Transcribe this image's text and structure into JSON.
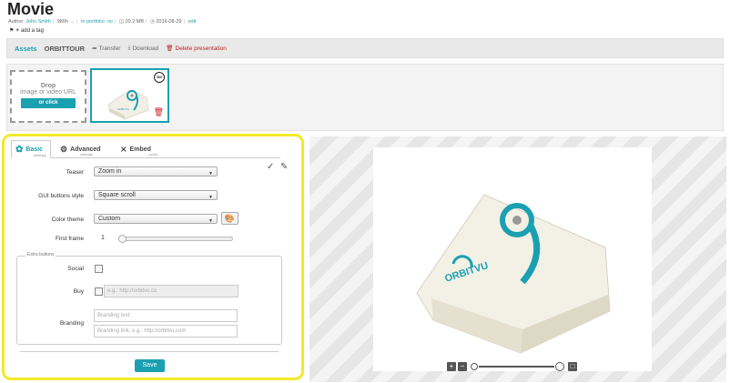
{
  "header": {
    "title": "Movie",
    "meta": {
      "author_label": "Author:",
      "author_name": "John Smith",
      "views": "980h",
      "arrow": "→",
      "portfolio": "In portfolio: no",
      "size": "20.2 MB",
      "date": "2016-08-29",
      "edit": "edit"
    },
    "tag_label": "add a tag"
  },
  "topbar": {
    "tabs": [
      "Assets",
      "ORBITTOUR"
    ],
    "actions": {
      "transfer": "Transfer",
      "download": "Download",
      "delete": "Delete presentation"
    }
  },
  "assets": {
    "drop_title": "Drop",
    "drop_subtitle": "image or video URL",
    "drop_button": "or click",
    "thumb_badge": "360",
    "thumb_brand": "ORBITVU"
  },
  "settings": {
    "tabs": [
      {
        "label": "Basic",
        "sub": "settings"
      },
      {
        "label": "Advanced",
        "sub": "settings"
      },
      {
        "label": "Embed",
        "sub": "codes"
      }
    ],
    "teaser_label": "Teaser",
    "teaser_value": "Zoom in",
    "gui_label": "GUI buttons style",
    "gui_value": "Square scroll",
    "color_label": "Color theme",
    "color_value": "Custom",
    "frame_label": "First frame",
    "frame_value": "1",
    "frame_position": 0,
    "extra_legend": "Extra buttons",
    "social_label": "Social",
    "buy_label": "Buy",
    "buy_placeholder": "e.g.: http://orbitvu.co",
    "branding_label": "Branding",
    "branding_text_placeholder": "Branding text",
    "branding_link_placeholder": "Branding link, e.g.: http://orbitvu.com",
    "save": "Save"
  },
  "viewer": {
    "brand": "ORBITVU",
    "zoom_level": 0
  },
  "colors": {
    "accent": "#1aa0b0",
    "highlight": "#f2e92a",
    "danger": "#b22222"
  }
}
